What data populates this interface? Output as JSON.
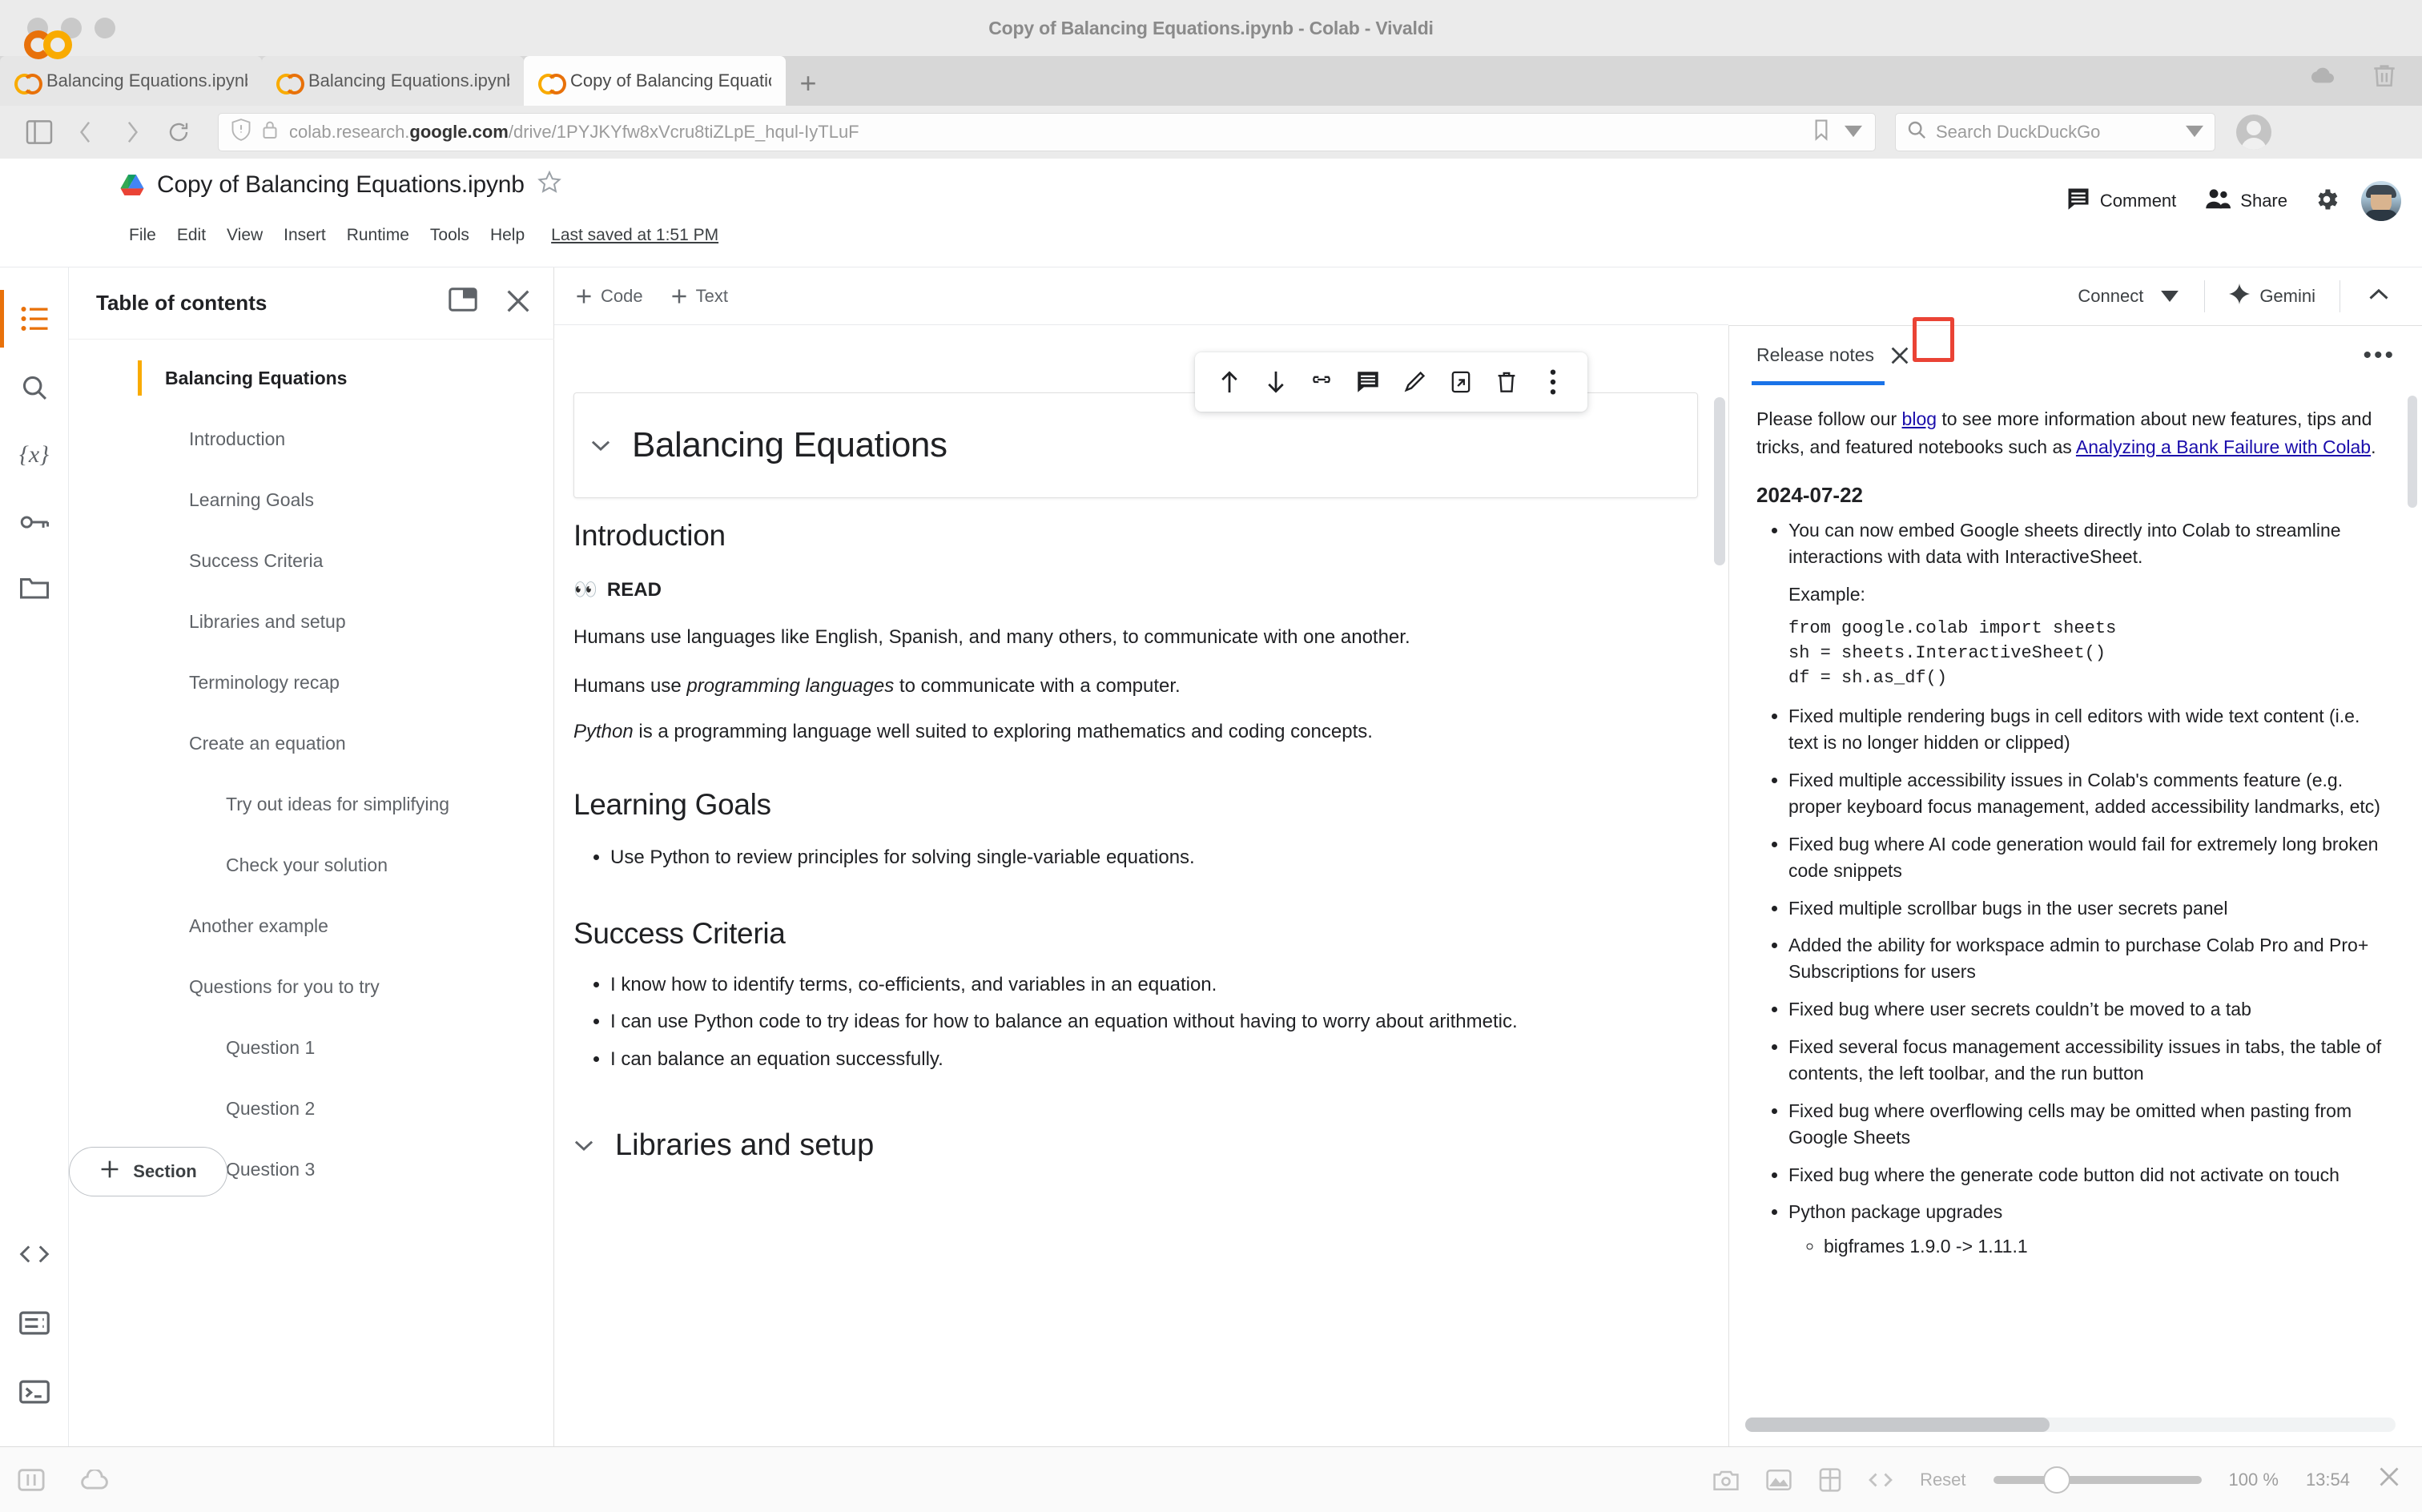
{
  "browser": {
    "window_title": "Copy of Balancing Equations.ipynb - Colab - Vivaldi",
    "tabs": [
      {
        "title": "Balancing Equations.ipynb",
        "active": false
      },
      {
        "title": "Balancing Equations.ipynb",
        "active": false
      },
      {
        "title": "Copy of Balancing Equations.ipynb",
        "active": true
      }
    ],
    "new_tab_label": "+",
    "url": {
      "prefix": "colab.research.",
      "domain": "google.com",
      "path": "/drive/1PYJKYfw8xVcru8tiZLpE_hqul-IyTLuF"
    },
    "search_placeholder": "Search DuckDuckGo"
  },
  "colab_header": {
    "doc_title": "Copy of Balancing Equations.ipynb",
    "menus": [
      "File",
      "Edit",
      "View",
      "Insert",
      "Runtime",
      "Tools",
      "Help"
    ],
    "last_saved": "Last saved at 1:51 PM",
    "comment_label": "Comment",
    "share_label": "Share"
  },
  "toc": {
    "title": "Table of contents",
    "items": [
      {
        "label": "Balancing Equations",
        "level": 0,
        "active": true
      },
      {
        "label": "Introduction",
        "level": 1
      },
      {
        "label": "Learning Goals",
        "level": 1
      },
      {
        "label": "Success Criteria",
        "level": 1
      },
      {
        "label": "Libraries and setup",
        "level": 1
      },
      {
        "label": "Terminology recap",
        "level": 1
      },
      {
        "label": "Create an equation",
        "level": 1
      },
      {
        "label": "Try out ideas for simplifying",
        "level": 2
      },
      {
        "label": "Check your solution",
        "level": 2
      },
      {
        "label": "Another example",
        "level": 1
      },
      {
        "label": "Questions for you to try",
        "level": 1
      },
      {
        "label": "Question 1",
        "level": 2
      },
      {
        "label": "Question 2",
        "level": 2
      },
      {
        "label": "Question 3",
        "level": 2
      }
    ],
    "add_section_label": "Section"
  },
  "notebook": {
    "add_code_label": "Code",
    "add_text_label": "Text",
    "cell_title": "Balancing Equations",
    "cell_toolbar_icons": [
      "move-cell-up-icon",
      "move-cell-down-icon",
      "link-to-cell-icon",
      "add-comment-icon",
      "edit-icon",
      "copy-to-drive-icon",
      "delete-cell-icon",
      "more-options-icon"
    ],
    "sections": {
      "introduction_heading": "Introduction",
      "read_badge": "READ",
      "para1": "Humans use languages like English, Spanish, and many others, to communicate with one another.",
      "para2_pre": "Humans use ",
      "para2_em": "programming languages",
      "para2_post": " to communicate with a computer.",
      "para3_em": "Python",
      "para3_post": " is a programming language well suited to exploring mathematics and coding concepts.",
      "learning_goals_heading": "Learning Goals",
      "learning_goals": [
        "Use Python to review principles for solving single-variable equations."
      ],
      "success_criteria_heading": "Success Criteria",
      "success_criteria": [
        "I know how to identify terms, co-efficients, and variables in an equation.",
        "I can use Python code to try ideas for how to balance an equation without having to worry about arithmetic.",
        "I can balance an equation successfully."
      ],
      "libraries_heading": "Libraries and setup"
    }
  },
  "runtime_bar": {
    "connect_label": "Connect",
    "gemini_label": "Gemini"
  },
  "release_notes": {
    "tab_label": "Release notes",
    "close_label": "✕",
    "more_label": "•••",
    "intro_pre": "Please follow our ",
    "intro_link1": "blog",
    "intro_mid": " to see more information about new features, tips and tricks, and featured notebooks such as ",
    "intro_link2": "Analyzing a Bank Failure with Colab",
    "intro_post": ".",
    "date": "2024-07-22",
    "items": [
      {
        "text": "You can now embed Google sheets directly into Colab to streamline interactions with data with InteractiveSheet.",
        "example_label": "Example:",
        "code": "from google.colab import sheets\nsh = sheets.InteractiveSheet()\ndf = sh.as_df()"
      },
      {
        "text": "Fixed multiple rendering bugs in cell editors with wide text content (i.e. text is no longer hidden or clipped)"
      },
      {
        "text": "Fixed multiple accessibility issues in Colab's comments feature (e.g. proper keyboard focus management, added accessibility landmarks, etc)"
      },
      {
        "text": "Fixed bug where AI code generation would fail for extremely long broken code snippets"
      },
      {
        "text": "Fixed multiple scrollbar bugs in the user secrets panel"
      },
      {
        "text": "Added the ability for workspace admin to purchase Colab Pro and Pro+ Subscriptions for users"
      },
      {
        "text": "Fixed bug where user secrets couldn’t be moved to a tab"
      },
      {
        "text": "Fixed several focus management accessibility issues in tabs, the table of contents, the left toolbar, and the run button"
      },
      {
        "text": "Fixed bug where overflowing cells may be omitted when pasting from Google Sheets"
      },
      {
        "text": "Fixed bug where the generate code button did not activate on touch"
      },
      {
        "text": "Python package upgrades",
        "subitems": [
          "bigframes 1.9.0 -> 1.11.1"
        ]
      }
    ]
  },
  "status_bar": {
    "reset_label": "Reset",
    "zoom_level": "100 %",
    "clock": "13:54"
  },
  "colors": {
    "colab_orange": "#E8710A",
    "colab_yellow": "#F9AB00",
    "link_blue": "#1a0dab",
    "tab_underline_blue": "#1a73e8",
    "highlight_red": "#ea4335"
  }
}
